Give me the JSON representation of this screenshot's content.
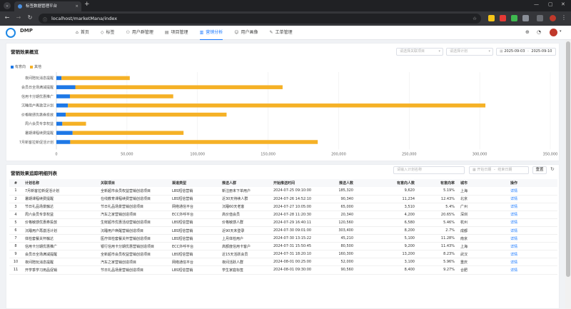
{
  "browser": {
    "tab_title": "标签数据管理平台",
    "url": "localhost/marketMana/index"
  },
  "header": {
    "logo_text": "DMP",
    "nav": [
      {
        "label": "首页",
        "icon": "home-icon"
      },
      {
        "label": "标签",
        "icon": "tag-icon"
      },
      {
        "label": "用户群管理",
        "icon": "users-icon"
      },
      {
        "label": "项目管理",
        "icon": "folder-icon"
      },
      {
        "label": "营销分析",
        "icon": "analytics-icon",
        "active": true
      },
      {
        "label": "用户画像",
        "icon": "user-icon"
      },
      {
        "label": "工单管理",
        "icon": "wrench-icon"
      }
    ]
  },
  "overview": {
    "title": "营销效果概览",
    "filter_project_placeholder": "请选择关联项目",
    "filter_plan_placeholder": "请选择计划",
    "date_start": "2025-09-03",
    "date_sep": "-",
    "date_end": "2025-09-10"
  },
  "chart_data": {
    "type": "bar",
    "orientation": "horizontal",
    "stacked": true,
    "categories": [
      "夜间陪玩消息提醒",
      "会员日全场满减提醒",
      "信用卡分期优惠推广",
      "沉睡用户再激活计划",
      "价格敏感优惠券投放",
      "周六会员专享权益",
      "暑期课程续费提醒",
      "7月新客拉新促活计划"
    ],
    "series": [
      {
        "name": "有意向",
        "color": "#1e78e6",
        "values": [
          3600,
          13400,
          9600,
          8200,
          6600,
          4200,
          11500,
          9800
        ]
      },
      {
        "name": "其他",
        "color": "#f5b126",
        "values": [
          48400,
          146900,
          73200,
          295800,
          114000,
          16800,
          78600,
          175400
        ]
      }
    ],
    "xlim": [
      0,
      350000
    ],
    "xticks": [
      "0",
      "50,000",
      "100,000",
      "150,000",
      "200,000",
      "250,000",
      "300,000",
      "350,000"
    ],
    "legend": "top-left"
  },
  "table_section": {
    "title": "营销效果追踪明细列表",
    "search_placeholder": "请输入计划名称",
    "date_start_placeholder": "开始日期",
    "date_sep": "-",
    "date_end_placeholder": "结束日期",
    "reset_label": "重置",
    "columns": [
      "#",
      "计划名称",
      "关联项目",
      "渠道类型",
      "推送人群",
      "开始推送时间",
      "推送人数",
      "有意向人数",
      "有意向率",
      "城市",
      "操作"
    ],
    "rows": [
      [
        "1",
        "7月新客拉新促活计划",
        "全新超市会员权益营销创造项目",
        "LBS短信营销",
        "新注册未下单用户",
        "2024-07-25 09:10:00",
        "185,320",
        "9,620",
        "5.19%",
        "上海",
        "详情"
      ],
      [
        "2",
        "暑期课程续费提醒",
        "在线教育课程续费营销创造项目",
        "LBS短信营销",
        "近30天待续人群",
        "2024-07-26 14:52:10",
        "90,340",
        "11,234",
        "12.43%",
        "北京",
        "详情"
      ],
      [
        "3",
        "节日礼品场景触达",
        "节日礼品场景营销创造项目",
        "网络通信平台",
        "沉睡60天老客",
        "2024-07-27 10:05:00",
        "65,000",
        "3,510",
        "5.4%",
        "广州",
        "详情"
      ],
      [
        "4",
        "周六会员专享权益",
        "汽车之家营销创造项目",
        "ECC外呼平台",
        "高价值会员",
        "2024-07-28 11:20:30",
        "20,340",
        "4,200",
        "20.65%",
        "深圳",
        "详情"
      ],
      [
        "5",
        "价格敏感优惠券投放",
        "生鲜超市优惠活动营销创造项目",
        "LBS短信营销",
        "价格敏感人群",
        "2024-07-29 16:40:11",
        "120,560",
        "6,580",
        "5.46%",
        "杭州",
        "详情"
      ],
      [
        "6",
        "沉睡用户再激活计划",
        "沉睡用户唤醒营销创造项目",
        "LBS短信营销",
        "近90天未登录",
        "2024-07-30 09:01:00",
        "303,400",
        "8,200",
        "2.7%",
        "成都",
        "详情"
      ],
      [
        "7",
        "体检套餐关怀触达",
        "医疗体检套餐关怀营销创造项目",
        "LBS短信营销",
        "上月体检用户",
        "2024-07-30 13:15:22",
        "45,210",
        "5,100",
        "11.28%",
        "南京",
        "详情"
      ],
      [
        "8",
        "信用卡分期优惠推广",
        "银行信用卡分期优惠营销创造项目",
        "ECC外呼平台",
        "高额度信用卡客户",
        "2024-07-31 15:50:45",
        "80,500",
        "9,200",
        "11.43%",
        "上海",
        "详情"
      ],
      [
        "9",
        "会员日全场满减提醒",
        "全新超市会员权益营销创造项目",
        "LBS短信营销",
        "近15天活跃会员",
        "2024-07-31 18:20:10",
        "160,300",
        "13,200",
        "8.23%",
        "武汉",
        "详情"
      ],
      [
        "10",
        "夜间陪玩消息提醒",
        "汽车之家营销创造项目",
        "网络通信平台",
        "夜间活跃人群",
        "2024-08-01 00:25:00",
        "52,000",
        "3,100",
        "5.96%",
        "重庆",
        "详情"
      ],
      [
        "11",
        "开学季学习用品促销",
        "节日礼品场景营销创造项目",
        "LBS短信营销",
        "学生家庭标签",
        "2024-08-01 09:30:00",
        "90,560",
        "8,400",
        "9.27%",
        "合肥",
        "详情"
      ]
    ]
  }
}
